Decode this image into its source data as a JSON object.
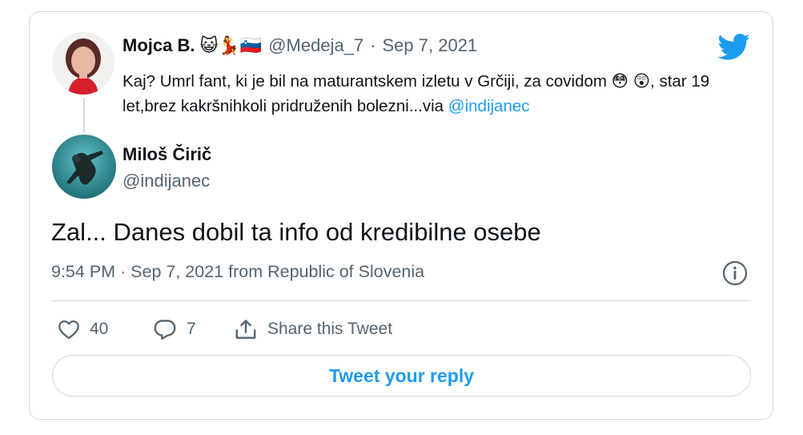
{
  "parent_tweet": {
    "author_name": "Mojca B.",
    "name_emojis": "😺💃🇸🇮",
    "handle": "@Medeja_7",
    "separator": "·",
    "date": "Sep 7, 2021",
    "text": "Kaj? Umrl fant, ki je bil na maturantskem izletu v Grčiji, za covidom 😳 😲, star 19 let,brez kakršnihkoli pridruženih bolezni...via ",
    "mention": "@indijanec"
  },
  "reply_tweet": {
    "author_name": "Miloš Čirič",
    "handle": "@indijanec",
    "text": "Zal... Danes dobil ta info od kredibilne osebe",
    "meta": "9:54 PM · Sep 7, 2021 from Republic of Slovenia"
  },
  "actions": {
    "like_count": "40",
    "reply_count": "7",
    "share_label": "Share this Tweet"
  },
  "reply_button_label": "Tweet your reply",
  "colors": {
    "accent": "#1d9bf0",
    "secondary_text": "#536471",
    "border": "#cfd9de"
  }
}
